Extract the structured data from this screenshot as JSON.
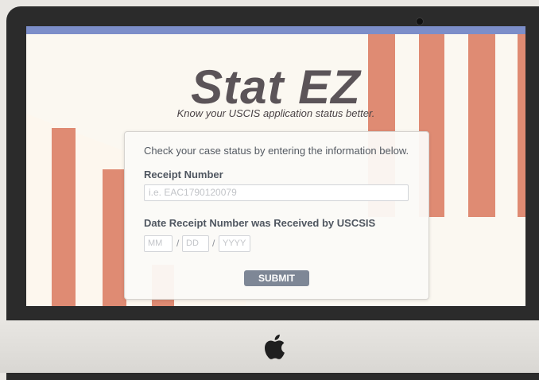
{
  "app": {
    "logo_text": "Stat EZ",
    "tagline": "Know your USCIS application status better."
  },
  "form": {
    "intro": "Check your case status by entering the information below.",
    "receipt_label": "Receipt Number",
    "receipt_placeholder": "i.e. EAC1790120079",
    "date_label": "Date Receipt Number was Received by USCSIS",
    "month_placeholder": "MM",
    "day_placeholder": "DD",
    "year_placeholder": "YYYY",
    "date_separator": "/",
    "submit_label": "SUBMIT"
  },
  "colors": {
    "accent_bar": "#7c8ec9",
    "stripe": "#df8b73",
    "button": "#7e8796"
  },
  "icons": {
    "brand": "apple-logo-icon"
  }
}
